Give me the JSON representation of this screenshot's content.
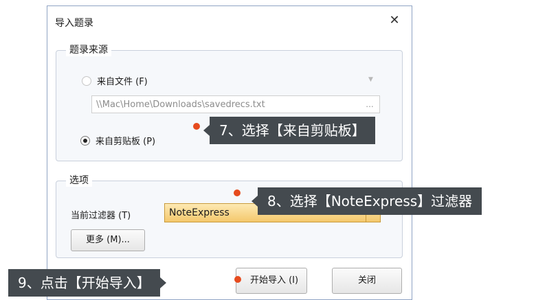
{
  "dialog": {
    "title": "导入题录",
    "close_glyph": "✕"
  },
  "source_group": {
    "legend": "题录来源",
    "from_file_label": "来自文件 (F)",
    "file_path_value": "\\\\Mac\\Home\\Downloads\\savedrecs.txt",
    "browse_label": "...",
    "from_clipboard_label": "来自剪贴板 (P)",
    "selected": "clipboard"
  },
  "options_group": {
    "legend": "选项",
    "filter_label": "当前过滤器 (T)",
    "filter_value": "NoteExpress",
    "more_button_label": "更多 (M)..."
  },
  "buttons": {
    "start_import_label": "开始导入 (I)",
    "close_label": "关闭"
  },
  "callouts": {
    "step7": "7、选择【来自剪贴板】",
    "step8": "8、选择【NoteExpress】过滤器",
    "step9": "9、点击【开始导入】"
  },
  "colors": {
    "callout_background": "#444a4f",
    "marker_dot": "#e64b1e",
    "filter_highlight": "#f4c86c"
  }
}
